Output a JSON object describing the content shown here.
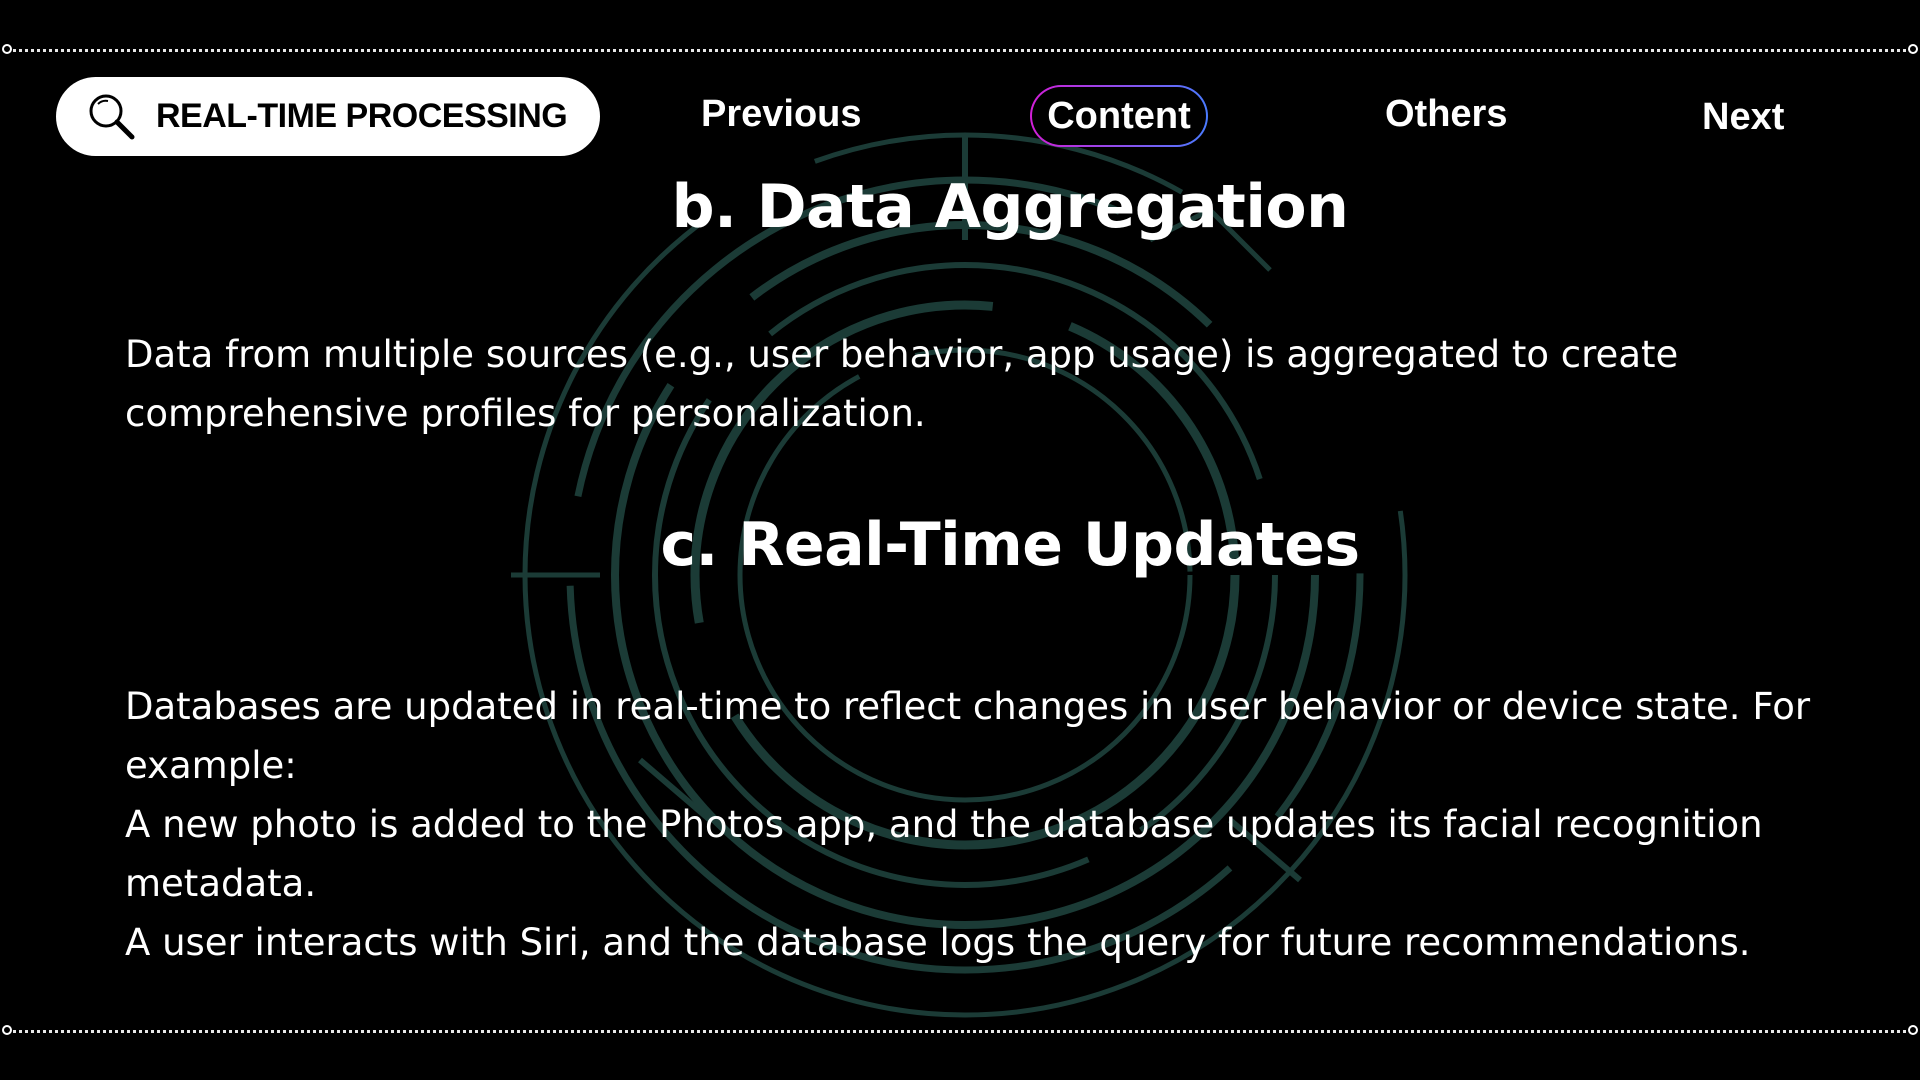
{
  "header": {
    "search_label": "REAL-TIME PROCESSING",
    "nav": {
      "previous": "Previous",
      "content": "Content",
      "others": "Others",
      "next": "Next"
    }
  },
  "sections": [
    {
      "heading": "b. Data Aggregation",
      "lines": [
        "Data from multiple sources (e.g., user behavior, app usage) is aggregated to create comprehensive profiles for personalization."
      ]
    },
    {
      "heading": "c. Real-Time Updates",
      "lines": [
        "Databases are updated in real-time to reflect changes in user behavior or device state. For example:",
        "A new photo is added to the Photos app, and the database updates its facial recognition metadata.",
        "A user interacts with Siri, and the database logs the query for future recommendations."
      ]
    }
  ],
  "colors": {
    "background": "#000000",
    "text": "#ffffff",
    "pill": "#ffffff",
    "accent_gradient_start": "#d21fd8",
    "accent_gradient_end": "#4a7bff",
    "background_art": "#1b3b36"
  },
  "icons": {
    "search": "magnifier-icon"
  }
}
